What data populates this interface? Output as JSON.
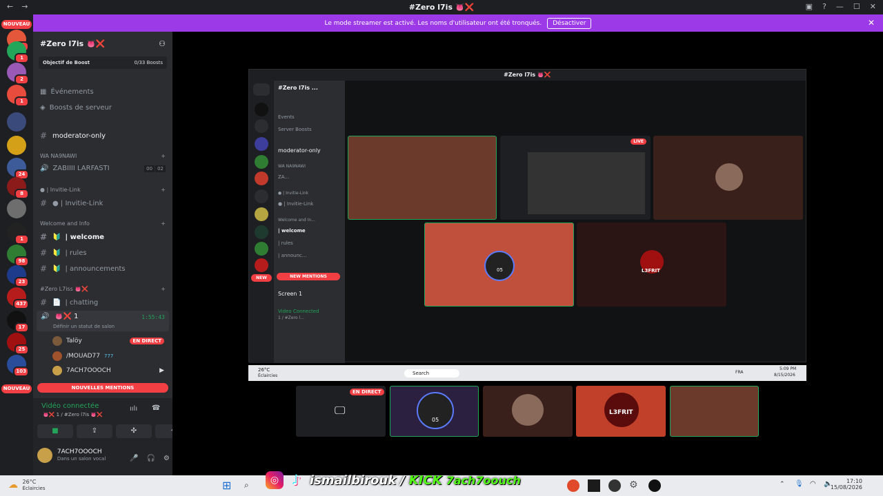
{
  "titlebar": {
    "title": "#Zero l7is 👅❌"
  },
  "banner": {
    "text": "Le mode streamer est activé. Les noms d'utilisateur ont été tronqués.",
    "button": "Désactiver"
  },
  "rail": {
    "new_top": "NOUVEAU",
    "new_bottom": "NOUVEAU",
    "badges": [
      "3",
      "1",
      "2",
      "1",
      "24",
      "8",
      "1",
      "98",
      "23",
      "437",
      "17",
      "25",
      "103"
    ]
  },
  "sidebar": {
    "server_name": "#Zero l7is 👅❌",
    "boost_label": "Objectif de Boost",
    "boost_count": "0/33 Boosts",
    "events": "Événements",
    "server_boosts": "Boosts de serveur",
    "ch_moderator": "moderator-only",
    "cat_wa": "WA NA9NAWI",
    "voice_zabiii": "ZABIIII LARFASTI",
    "voice_counts": [
      "00",
      "02"
    ],
    "cat_invite": "● | Invitie-Link",
    "ch_invite": "● | Invitie-Link",
    "cat_welcome": "Welcome and Info",
    "ch_welcome": "| welcome",
    "ch_rules": "| rules",
    "ch_announce": "| announcements",
    "cat_zero": "#Zero L7iss 👅❌",
    "ch_chatting": "| chatting",
    "voice_active": "👅❌ 1",
    "voice_timer": "1:55:43",
    "voice_status": "Définir un statut de salon",
    "members": [
      {
        "name": "Talöy",
        "badge": "EN DIRECT"
      },
      {
        "name": "/MOUAD77",
        "badge": "777"
      },
      {
        "name": "7ACH7OOOCH",
        "badge": ""
      }
    ],
    "new_mentions": "NOUVELLES MENTIONS"
  },
  "rtc": {
    "status": "Vidéo connectée",
    "sub": "👅❌ 1 / #Zero l7is 👅❌",
    "user": "7ACH7OOOCH",
    "user_status": "Dans un salon vocal"
  },
  "inner_window": {
    "title": "#Zero l7is 👅❌",
    "server": "#Zero l7is ...",
    "events": "Events",
    "server_boosts": "Server Boosts",
    "moderator": "moderator-only",
    "cat": "WA NA9NAWI",
    "voice": "ZA...",
    "invite_cat": "● | Invitie-Link",
    "invite": "● | Invitie-Link",
    "welcome_cat": "Welcome and In...",
    "welcome": "| welcome",
    "rules": "| rules",
    "announce": "| announc...",
    "new": "NEW",
    "new_mentions": "NEW MENTIONS",
    "screen": "Screen 1",
    "video_connected": "Video Connected",
    "sub": "1 / #Zero l...",
    "live": "LIVE",
    "tile_names": [
      "05",
      "L3FRIT"
    ],
    "taskbar_weather": "26°C",
    "taskbar_weather2": "Éclaircies",
    "taskbar_search": "Search",
    "taskbar_lang": "FRA",
    "taskbar_time": "5:09 PM",
    "taskbar_date": "8/15/2026"
  },
  "stage": {
    "live_label": "EN DIRECT",
    "tile_names": [
      "05",
      "L3FRIT"
    ]
  },
  "taskbar": {
    "weather_temp": "26°C",
    "weather_desc": "Éclaircies",
    "time": "17:10",
    "date": "15/08/2026"
  },
  "overlay": {
    "handle": "ismailbirouk",
    "kick_label": "KICK",
    "kick_name": "7ach7oouch"
  }
}
